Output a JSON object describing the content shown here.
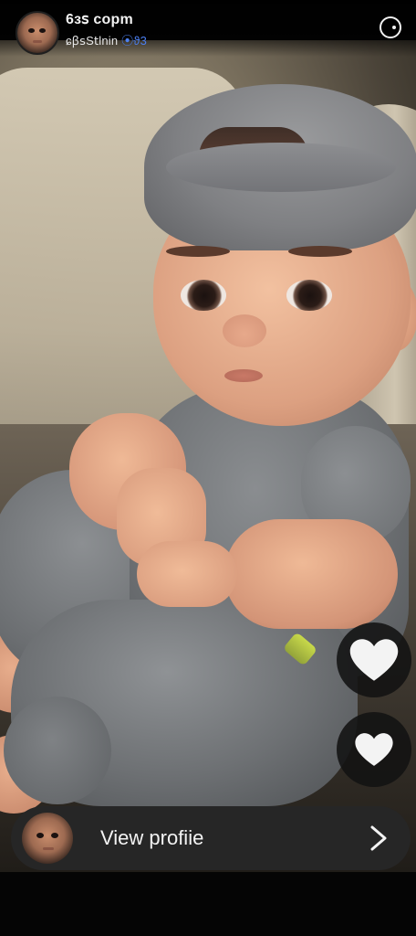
{
  "header": {
    "title": "6ɜ𝗌 copm",
    "subtitle_text": "ɕꞵ𝗌S𝗍lnin",
    "subtitle_accent": "⦿ϑ3",
    "avatar_icon": "avatar-icon",
    "action_icon": "emoji-smile-icon"
  },
  "actions": {
    "like_icon": "heart-icon",
    "like2_icon": "heart-icon"
  },
  "bottom": {
    "label": "View profiie",
    "icon": "chevron-right-icon"
  },
  "colors": {
    "background": "#050505",
    "bar": "#262626",
    "text": "#f3f3f3",
    "accent": "#4b7ff0"
  }
}
